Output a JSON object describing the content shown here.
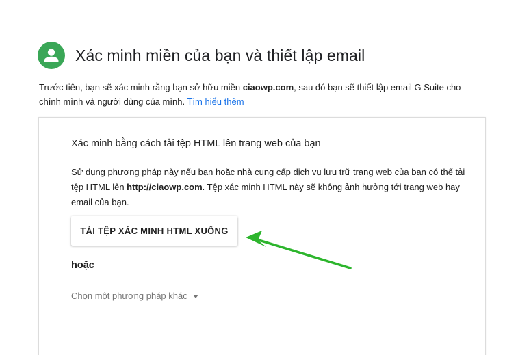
{
  "header": {
    "title": "Xác minh miền của bạn và thiết lập email",
    "avatar_icon": "person-icon",
    "avatar_color": "#3aa757"
  },
  "intro": {
    "text_before": "Trước tiên, bạn sẽ xác minh rằng bạn sở hữu miền ",
    "domain": "ciaowp.com",
    "text_after": ", sau đó bạn sẽ thiết lập email G Suite cho chính mình và người dùng của mình. ",
    "learn_more_label": "Tìm hiểu thêm",
    "link_color": "#1a73e8"
  },
  "card": {
    "title": "Xác minh bằng cách tải tệp HTML lên trang web của bạn",
    "desc_before": "Sử dụng phương pháp này nếu bạn hoặc nhà cung cấp dịch vụ lưu trữ trang web của bạn có thể tải tệp HTML lên ",
    "desc_url": "http://ciaowp.com",
    "desc_after": ". Tệp xác minh HTML này sẽ không ảnh hưởng tới trang web hay email của bạn.",
    "download_button_label": "TẢI TỆP XÁC MINH HTML XUỐNG",
    "or_label": "hoặc",
    "method_select": {
      "selected": "Chọn một phương pháp khác",
      "caret_icon": "caret-down-icon"
    }
  },
  "annotation": {
    "arrow_icon": "green-arrow-icon",
    "arrow_color": "#2db52d"
  }
}
